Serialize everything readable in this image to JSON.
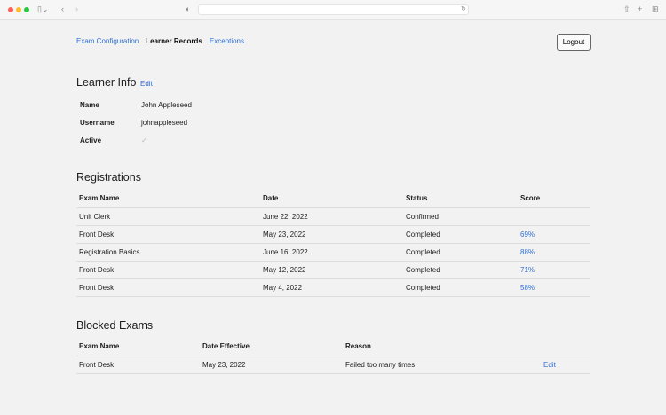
{
  "browser": {
    "icons": [
      "sidebar-icon",
      "back-icon",
      "forward-icon",
      "shield-icon",
      "reload-icon",
      "share-icon",
      "new-tab-icon",
      "tabs-icon"
    ]
  },
  "nav": {
    "items": [
      "Exam Configuration",
      "Learner Records",
      "Exceptions"
    ],
    "logout": "Logout"
  },
  "learner": {
    "title": "Learner Info",
    "edit": "Edit",
    "fields": [
      {
        "label": "Name",
        "value": "John Appleseed"
      },
      {
        "label": "Username",
        "value": "johnappleseed"
      },
      {
        "label": "Active",
        "value": "✓"
      }
    ]
  },
  "registrations": {
    "title": "Registrations",
    "headers": [
      "Exam Name",
      "Date",
      "Status",
      "Score"
    ],
    "rows": [
      [
        "Unit Clerk",
        "June 22, 2022",
        "Confirmed",
        ""
      ],
      [
        "Front Desk",
        "May 23, 2022",
        "Completed",
        "69%"
      ],
      [
        "Registration Basics",
        "June 16, 2022",
        "Completed",
        "88%"
      ],
      [
        "Front Desk",
        "May 12, 2022",
        "Completed",
        "71%"
      ],
      [
        "Front Desk",
        "May 4, 2022",
        "Completed",
        "58%"
      ]
    ]
  },
  "blocked": {
    "title": "Blocked Exams",
    "headers": [
      "Exam Name",
      "Date Effective",
      "Reason",
      ""
    ],
    "rows": [
      [
        "Front Desk",
        "May 23, 2022",
        "Failed too many times",
        "Edit"
      ]
    ]
  }
}
